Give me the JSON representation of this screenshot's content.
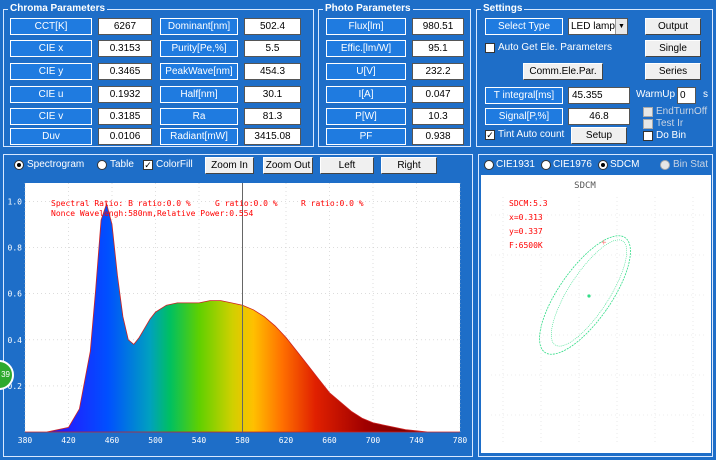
{
  "chroma": {
    "title": "Chroma  Parameters",
    "left": [
      {
        "label": "CCT[K]",
        "value": "6267"
      },
      {
        "label": "CIE x",
        "value": "0.3153"
      },
      {
        "label": "CIE y",
        "value": "0.3465"
      },
      {
        "label": "CIE u",
        "value": "0.1932"
      },
      {
        "label": "CIE v",
        "value": "0.3185"
      },
      {
        "label": "Duv",
        "value": "0.0106"
      }
    ],
    "right": [
      {
        "label": "Dominant[nm]",
        "value": "502.4"
      },
      {
        "label": "Purity[Pe,%]",
        "value": "5.5"
      },
      {
        "label": "PeakWave[nm]",
        "value": "454.3"
      },
      {
        "label": "Half[nm]",
        "value": "30.1"
      },
      {
        "label": "Ra",
        "value": "81.3"
      },
      {
        "label": "Radiant[mW]",
        "value": "3415.08"
      }
    ]
  },
  "photo": {
    "title": "Photo Parameters",
    "items": [
      {
        "label": "Flux[lm]",
        "value": "980.51"
      },
      {
        "label": "Effic.[lm/W]",
        "value": "95.1"
      },
      {
        "label": "U[V]",
        "value": "232.2"
      },
      {
        "label": "I[A]",
        "value": "0.047"
      },
      {
        "label": "P[W]",
        "value": "10.3"
      },
      {
        "label": "PF",
        "value": "0.938"
      }
    ]
  },
  "settings": {
    "title": "Settings",
    "select_type_label": "Select Type",
    "select_type_value": "LED lamp",
    "output_label": "Output",
    "auto_get_label": "Auto Get Ele. Parameters",
    "single_label": "Single",
    "comm_label": "Comm.Ele.Par.",
    "series_label": "Series",
    "tintegral_label": "T integral[ms]",
    "tintegral_value": "45.355",
    "warmup_label": "WarmUp",
    "warmup_value": "0",
    "warmup_unit": "s",
    "endturnoff_label": "EndTurnOff",
    "signal_label": "Signal[P,%]",
    "signal_value": "46.8",
    "testir_label": "Test Ir",
    "tint_auto_label": "Tint Auto count",
    "setup_label": "Setup",
    "dobin_label": "Do Bin"
  },
  "spectro": {
    "tabs": {
      "spectrogram": "Spectrogram",
      "table": "Table",
      "colorfill": "ColorFill"
    },
    "buttons": {
      "zoom_in": "Zoom In",
      "zoom_out": "Zoom Out",
      "left": "Left",
      "right": "Right"
    },
    "ratio_b": "Spectral Ratio:  B ratio:0.0 %",
    "ratio_g": "G ratio:0.0 %",
    "ratio_r": "R ratio:0.0 %",
    "nonce": "Nonce Wavelengh:580nm,Relative Power:0.554",
    "side_badge": "39"
  },
  "right_panel": {
    "tabs": {
      "cie1931": "CIE1931",
      "cie1976": "CIE1976",
      "sdcm": "SDCM",
      "binstat": "Bin Stat"
    },
    "plot_title": "SDCM",
    "sdcm": "SDCM:5.3",
    "x": "x=0.313",
    "y": "y=0.337",
    "f": "F:6500K"
  },
  "colors": {
    "background": "#1e6ec8",
    "plot_bg": "#ffffff",
    "spectrum_text": "#ff0000",
    "sdcm_ellipse": "#33dd88"
  },
  "chart_data": {
    "type": "area",
    "x": [
      380,
      400,
      420,
      430,
      440,
      445,
      450,
      455,
      460,
      465,
      470,
      475,
      480,
      485,
      490,
      495,
      500,
      510,
      520,
      530,
      540,
      550,
      560,
      570,
      580,
      590,
      600,
      610,
      620,
      630,
      640,
      650,
      660,
      670,
      680,
      690,
      700,
      710,
      720,
      730,
      740,
      750,
      760,
      770,
      780
    ],
    "y": [
      0.0,
      0.0,
      0.02,
      0.1,
      0.35,
      0.62,
      0.92,
      0.99,
      0.9,
      0.68,
      0.5,
      0.4,
      0.38,
      0.41,
      0.45,
      0.49,
      0.52,
      0.55,
      0.56,
      0.56,
      0.56,
      0.57,
      0.57,
      0.56,
      0.55,
      0.53,
      0.5,
      0.46,
      0.41,
      0.35,
      0.29,
      0.23,
      0.17,
      0.13,
      0.09,
      0.06,
      0.04,
      0.03,
      0.02,
      0.01,
      0.005,
      0.0,
      0.0,
      0.0,
      0.0
    ],
    "xlim": [
      380,
      780
    ],
    "ylim": [
      0,
      1.0
    ],
    "xticks": [
      "380",
      "420",
      "460",
      "500",
      "540",
      "580",
      "620",
      "660",
      "700",
      "740",
      "780"
    ],
    "yticks": [
      "0.2",
      "0.4",
      "0.6",
      "0.8",
      "1.0"
    ],
    "marker_x": 580,
    "fill": "spectral"
  }
}
